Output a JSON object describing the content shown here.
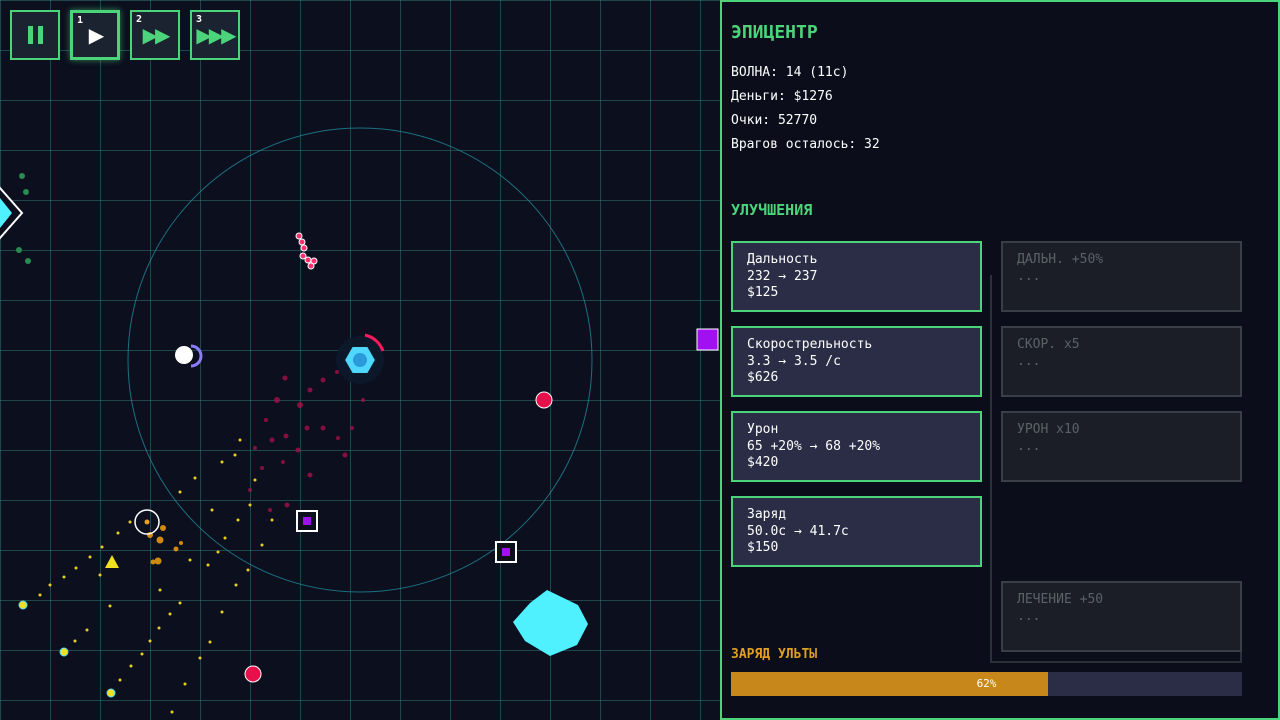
{
  "speed_controls": [
    {
      "label": "",
      "icon": "pause-icon",
      "active": false
    },
    {
      "label": "1",
      "icon": "play-icon",
      "active": true
    },
    {
      "label": "2",
      "icon": "fast-forward-icon",
      "active": false
    },
    {
      "label": "3",
      "icon": "fastest-forward-icon",
      "active": false
    }
  ],
  "panel": {
    "title": "ЭПИЦЕНТР",
    "wave": "ВОЛНА: 14 (11с)",
    "money": "Деньги: $1276",
    "score": "Очки: 52770",
    "enemies_left": "Врагов осталось: 32",
    "upgrades_title": "УЛУЧШЕНИЯ",
    "upgrades": [
      {
        "name": "Дальность",
        "change": "232 → 237",
        "cost": "$125"
      },
      {
        "name": "Скорострельность",
        "change": "3.3 → 3.5 /с",
        "cost": "$626"
      },
      {
        "name": "Урон",
        "change": "65 +20% → 68 +20%",
        "cost": "$420"
      },
      {
        "name": "Заряд",
        "change": "50.0с → 41.7с",
        "cost": "$150"
      }
    ],
    "tiers": [
      {
        "name": "ДАЛЬН. +50%",
        "detail": "..."
      },
      {
        "name": "СКОР. x5",
        "detail": "..."
      },
      {
        "name": "УРОН x10",
        "detail": "..."
      },
      {
        "name": "ЛЕЧЕНИЕ +50",
        "detail": "..."
      }
    ],
    "ult_label": "ЗАРЯД УЛЬТЫ",
    "ult_percent": 62,
    "ult_text": "62%"
  },
  "colors": {
    "accent": "#4bd47a",
    "ult": "#c8871a",
    "enemy_red": "#e8104a",
    "enemy_purple": "#a010f0",
    "enemy_cyan": "#4ff0ff",
    "tower": "#4fd8ff"
  }
}
